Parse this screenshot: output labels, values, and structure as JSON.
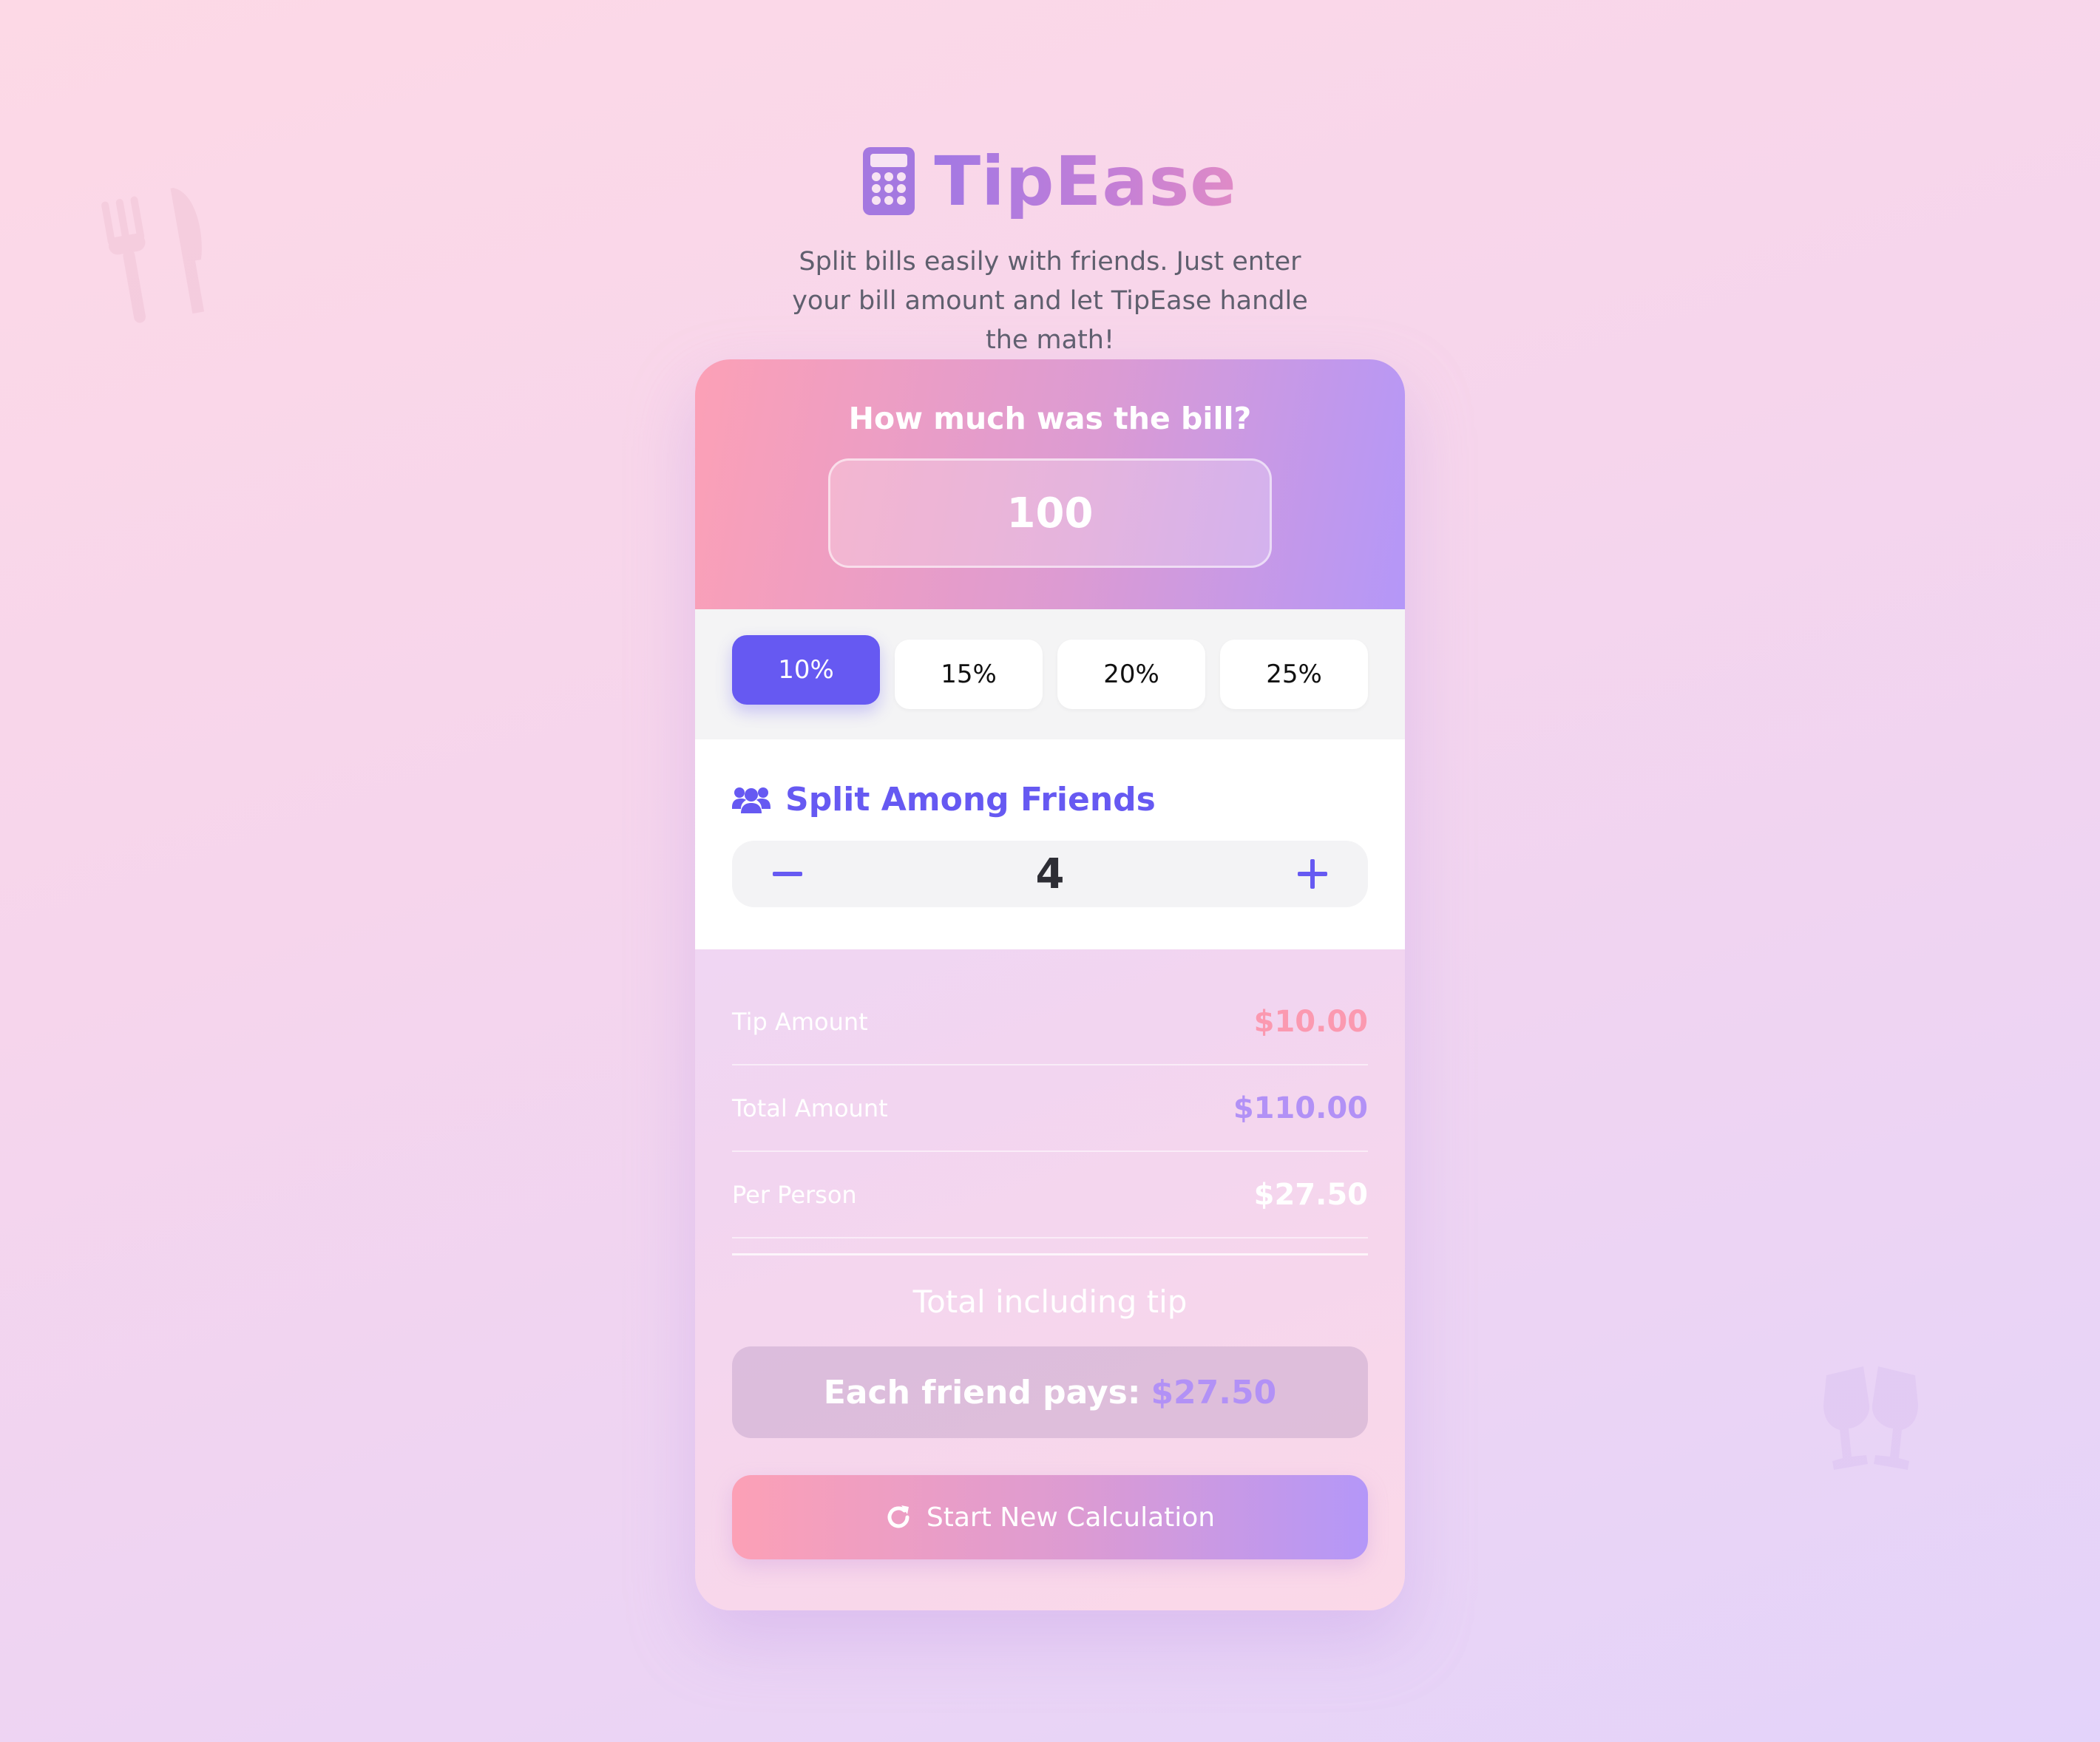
{
  "app": {
    "title": "TipEase",
    "subtitle": "Split bills easily with friends. Just enter your bill amount and let TipEase handle the math!"
  },
  "bill": {
    "question": "How much was the bill?",
    "value": "100"
  },
  "tips": {
    "options": [
      "10%",
      "15%",
      "20%",
      "25%"
    ],
    "selected": "10%"
  },
  "split": {
    "title": "Split Among Friends",
    "count": "4"
  },
  "results": {
    "tip_label": "Tip Amount",
    "tip_value": "$10.00",
    "total_label": "Total Amount",
    "total_value": "$110.00",
    "per_person_label": "Per Person",
    "per_person_value": "$27.50",
    "total_caption": "Total including tip",
    "each_pays_label": "Each friend pays:",
    "each_pays_value": "$27.50",
    "new_calc_label": "Start New Calculation"
  },
  "icons": {
    "brand": "calculator-icon",
    "split": "users-icon",
    "decrement": "minus-icon",
    "increment": "plus-icon",
    "reset": "refresh-icon",
    "background_left": "utensils-icon",
    "background_right": "glasses-cheers-icon"
  },
  "colors": {
    "accent": "#6659f2",
    "pink": "#fca0b6",
    "lavender": "#b497f8"
  }
}
